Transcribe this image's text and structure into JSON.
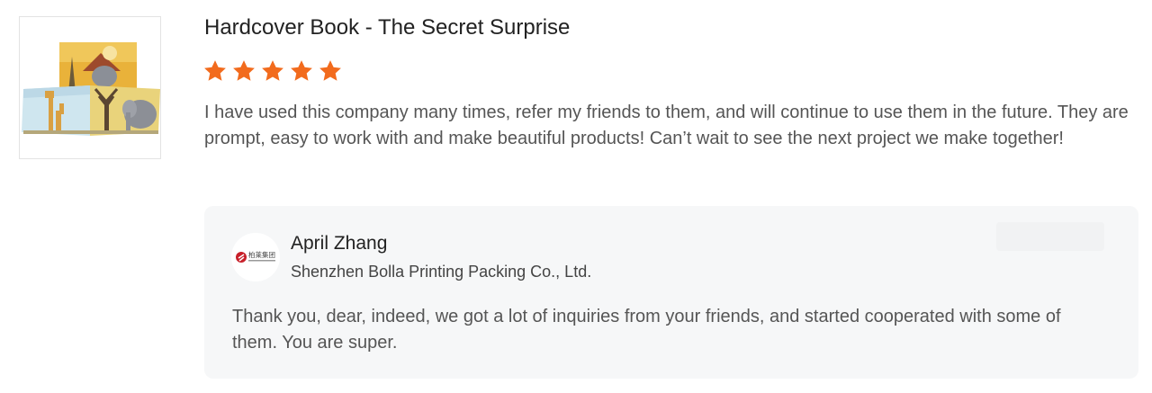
{
  "product": {
    "title": "Hardcover Book - The Secret Surprise",
    "image_alt_icon": "book-photo-icon"
  },
  "rating": {
    "stars": 5,
    "max": 5,
    "color": "#f26b1d"
  },
  "review": {
    "text": "I have used this company many times, refer my friends to them, and will continue to use them in the future. They are prompt, easy to work with and make beautiful products! Can’t wait to see the next project we make together!"
  },
  "reply": {
    "name": "April Zhang",
    "company": "Shenzhen Bolla Printing Packing Co., Ltd.",
    "text": "Thank you, dear, indeed, we got a lot of inquiries from your friends, and started cooperated with some of them. You are super.",
    "avatar_icon": "company-logo-icon",
    "logo_text": "柏莱集团",
    "background": "#f6f7f8"
  }
}
